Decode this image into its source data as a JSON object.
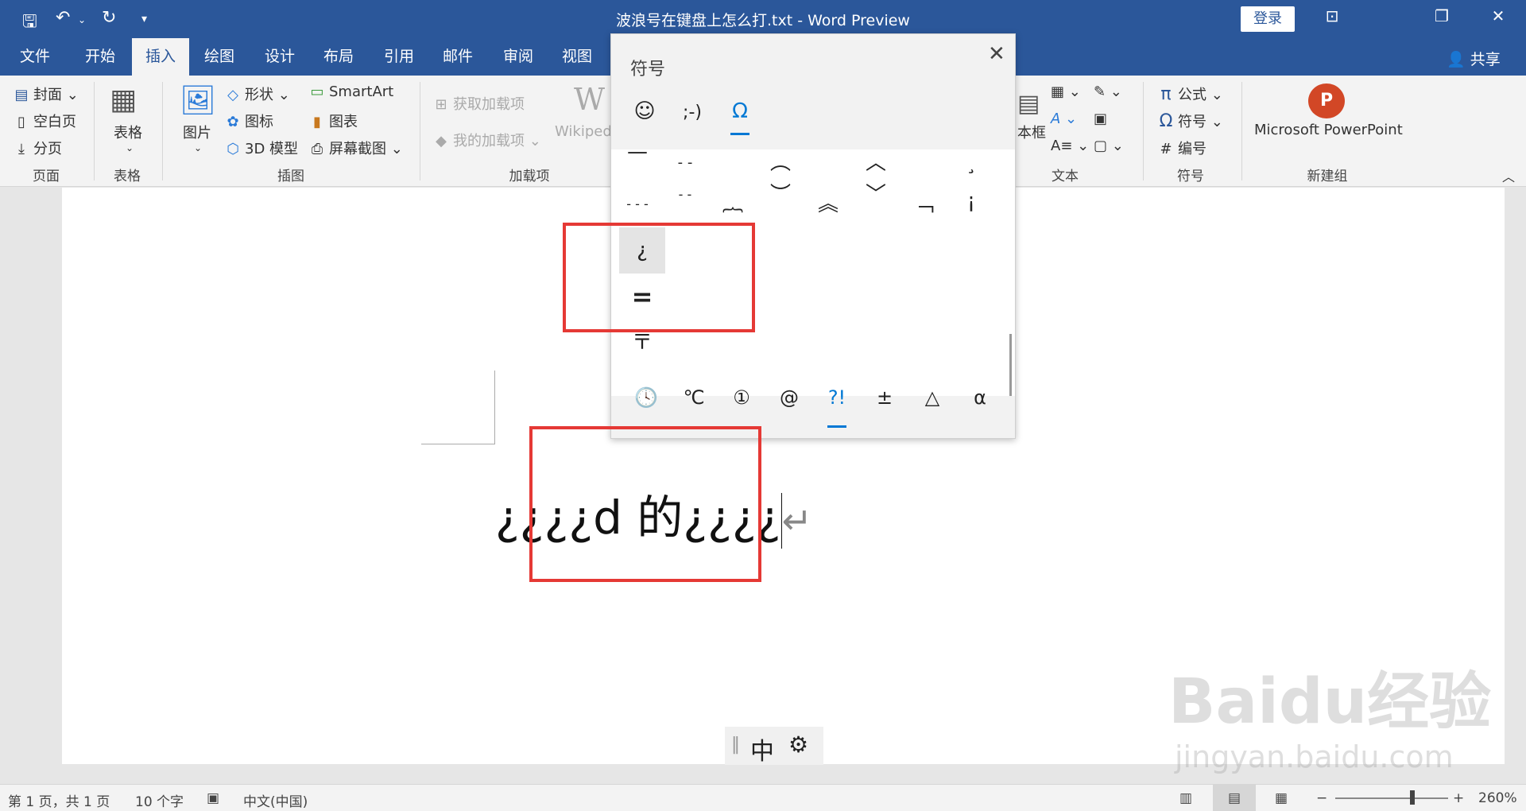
{
  "window": {
    "title": "波浪号在键盘上怎么打.txt  -  Word Preview",
    "login_label": "登录",
    "share_label": "共享"
  },
  "tabs": [
    "文件",
    "开始",
    "插入",
    "绘图",
    "设计",
    "布局",
    "引用",
    "邮件",
    "审阅",
    "视图"
  ],
  "active_tab": "插入",
  "ribbon": {
    "pages": {
      "cover": "封面",
      "blank": "空白页",
      "break": "分页",
      "group": "页面"
    },
    "table": {
      "label": "表格",
      "group": "表格"
    },
    "illustrations": {
      "picture": "图片",
      "shapes": "形状",
      "icons": "图标",
      "model3d": "3D 模型",
      "smartart": "SmartArt",
      "chart": "图表",
      "screenshot": "屏幕截图",
      "group": "插图"
    },
    "addins": {
      "get": "获取加载项",
      "my": "我的加载项",
      "wiki": "Wikiped",
      "group": "加载项"
    },
    "text": {
      "textbox": "本框",
      "group": "文本"
    },
    "symbols": {
      "equation": "公式",
      "symbol": "符号",
      "number": "编号",
      "group": "符号"
    },
    "newgroup": {
      "ppt": "Microsoft PowerPoint",
      "group": "新建组"
    }
  },
  "symbol_panel": {
    "title": "符号",
    "tabs": [
      "☺",
      ";-)",
      "Ω"
    ],
    "row1": [
      "—",
      "- -",
      "︶",
      "︵",
      "︸",
      "︿",
      "﹂",
      "¸"
    ],
    "row2": [
      "- - -",
      "- -",
      "︷",
      "︶",
      "︽",
      "﹀",
      "﹁",
      "¡"
    ],
    "row3": [
      "¿"
    ],
    "row4": [
      "="
    ],
    "row5": [
      "〒"
    ],
    "categories": [
      "🕓",
      "℃",
      "①",
      "@",
      "?!",
      "±",
      "△",
      "α"
    ]
  },
  "document": {
    "text": "¿¿¿¿d 的¿¿¿¿",
    "pilcrow": "↵"
  },
  "ime": {
    "mode": "中"
  },
  "status": {
    "page": "第 1 页，共 1 页",
    "words": "10 个字",
    "language": "中文(中国)",
    "zoom": "260%"
  },
  "watermark": {
    "logo": "Baidu经验",
    "url": "jingyan.baidu.com"
  }
}
